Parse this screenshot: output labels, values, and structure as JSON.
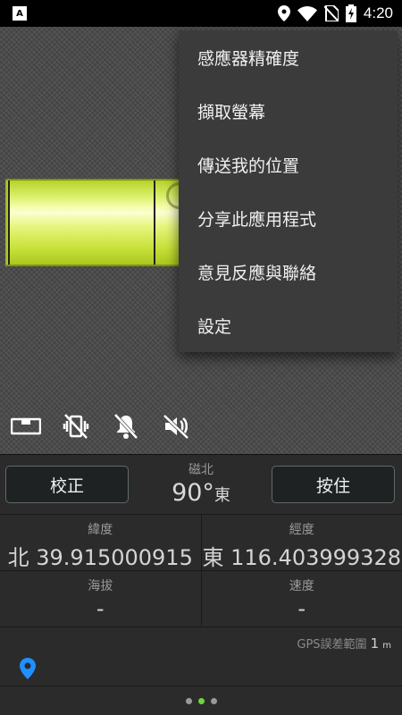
{
  "status_bar": {
    "app_badge": "A",
    "time": "4:20",
    "icons": [
      "location-icon",
      "wifi-icon",
      "no-sim-icon",
      "battery-charging-icon"
    ]
  },
  "toolbar_icons": [
    "level-icon",
    "vibrate-off-icon",
    "notifications-off-icon",
    "volume-off-icon"
  ],
  "menu": {
    "items": [
      {
        "label": "感應器精確度"
      },
      {
        "label": "擷取螢幕"
      },
      {
        "label": "傳送我的位置"
      },
      {
        "label": "分享此應用程式"
      },
      {
        "label": "意見反應與聯絡"
      },
      {
        "label": "設定"
      }
    ]
  },
  "panel": {
    "calibrate_label": "校正",
    "hold_label": "按住",
    "heading": {
      "label": "磁北",
      "value": "90°",
      "direction": "東"
    },
    "latitude": {
      "label": "緯度",
      "value": "北 39.915000915"
    },
    "longitude": {
      "label": "經度",
      "value": "東 116.403999328"
    },
    "altitude": {
      "label": "海拔",
      "value": "-"
    },
    "speed": {
      "label": "速度",
      "value": "-"
    },
    "gps_accuracy": {
      "label": "GPS誤差範圍",
      "value": "1",
      "unit": "m"
    },
    "pager": {
      "count": 3,
      "active": 1
    }
  },
  "colors": {
    "accent_green": "#6fd43a",
    "location_blue": "#1e90ff",
    "vial_green": "#d8ee66"
  }
}
